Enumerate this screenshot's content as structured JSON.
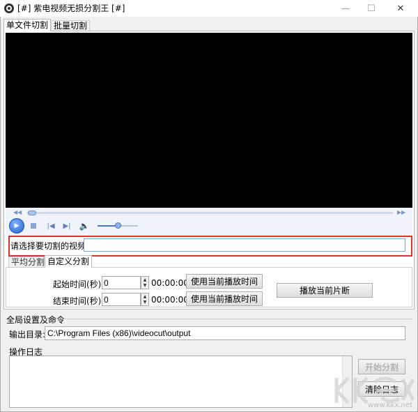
{
  "window": {
    "title": "[#] 紫电视频无损分割王 [#]",
    "minimize_glyph": "—",
    "maximize_glyph": "☐",
    "close_glyph": "✕"
  },
  "tabs": [
    {
      "label": "单文件切割",
      "active": true
    },
    {
      "label": "批量切割",
      "active": false
    }
  ],
  "player": {
    "seek_progress": 0.01,
    "volume_level": 0.5,
    "icons": [
      "play-icon",
      "stop-icon",
      "prev-icon",
      "next-icon",
      "volume-icon"
    ]
  },
  "select_video": {
    "label": "请选择要切割的视频:",
    "value": ""
  },
  "sub_tabs": [
    {
      "label": "平均分割",
      "active": false
    },
    {
      "label": "自定义分割",
      "active": true
    }
  ],
  "custom_split": {
    "start_label": "起始时间(秒):",
    "start_value": "0",
    "start_time": "00:00:00",
    "end_label": "结束时间(秒):",
    "end_value": "0",
    "end_time": "00:00:00",
    "use_current_label": "使用当前播放时间",
    "play_segment_label": "播放当前片断"
  },
  "global": {
    "section_title": "全局设置及命令",
    "output_label": "输出目录:",
    "output_value": "C:\\Program Files (x86)\\videocut\\output",
    "log_title": "操作日志",
    "start_button": "开始分割",
    "clear_button": "清除日志"
  },
  "watermark": {
    "site": "www.kkx.net"
  },
  "colors": {
    "highlight_border": "#e0312b",
    "video_bg": "#000000",
    "accent": "#1f5fcc"
  }
}
